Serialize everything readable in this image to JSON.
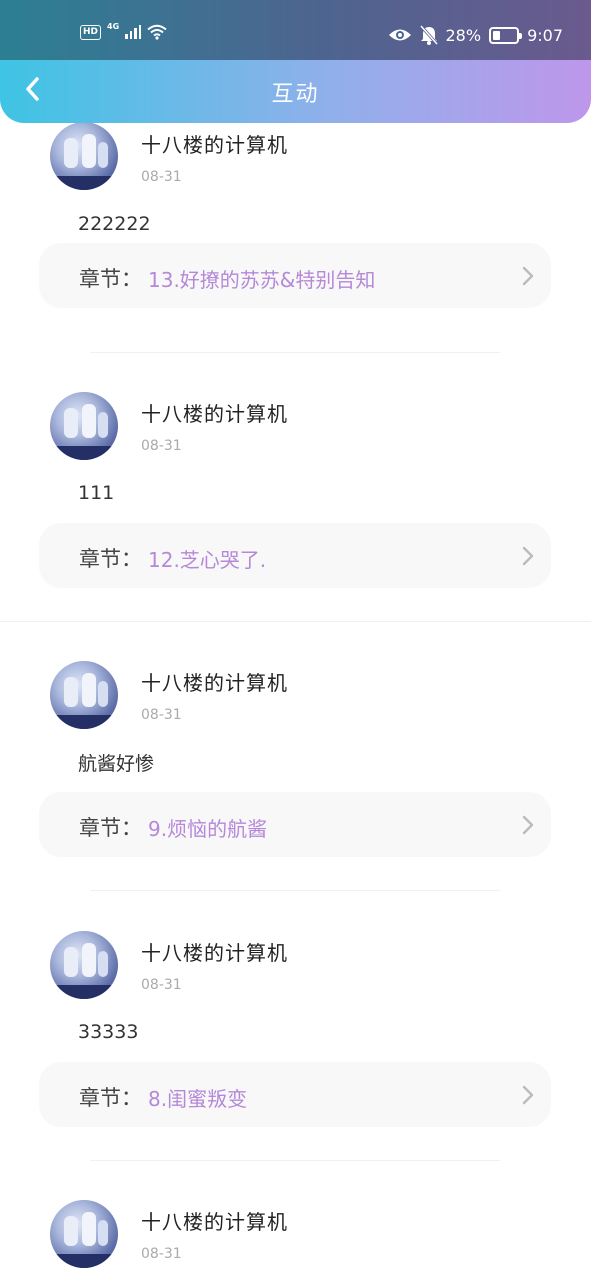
{
  "status_bar": {
    "hd": "HD",
    "network": "4G",
    "battery": "28%",
    "time": "9:07"
  },
  "navbar": {
    "title": "互动"
  },
  "chapter_label": "章节：",
  "comments": [
    {
      "user": "十八楼的计算机",
      "date": "08-31",
      "text": "222222",
      "chapter": "13.好撩的苏苏&特别告知"
    },
    {
      "user": "十八楼的计算机",
      "date": "08-31",
      "text": "111",
      "chapter": "12.芝心哭了."
    },
    {
      "user": "十八楼的计算机",
      "date": "08-31",
      "text": "航酱好惨",
      "chapter": "9.烦恼的航酱"
    },
    {
      "user": "十八楼的计算机",
      "date": "08-31",
      "text": "33333",
      "chapter": "8.闺蜜叛变"
    },
    {
      "user": "十八楼的计算机",
      "date": "08-31"
    }
  ]
}
